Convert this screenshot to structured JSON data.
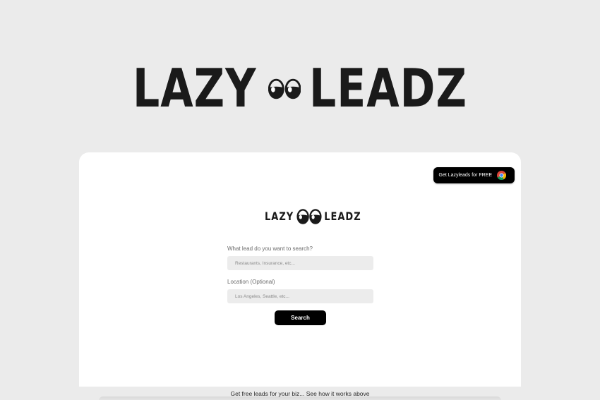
{
  "brand": {
    "word_left": "LAZY",
    "word_right": "LEADZ"
  },
  "card": {
    "extension_button_label": "Get Lazyleads for FREE",
    "extension_icon": "chrome-icon",
    "lead_label": "What lead do you want to search?",
    "lead_placeholder": "Restaurants, Insurance, etc...",
    "location_label": "Location (Optional)",
    "location_placeholder": "Los Angeles, Seattle, etc...",
    "search_label": "Search"
  },
  "footer": {
    "text": "Get free leads for your biz... See how it works above"
  },
  "colors": {
    "background": "#ebebeb",
    "card": "#ffffff",
    "button": "#000000",
    "logo": "#1a1a1a"
  }
}
